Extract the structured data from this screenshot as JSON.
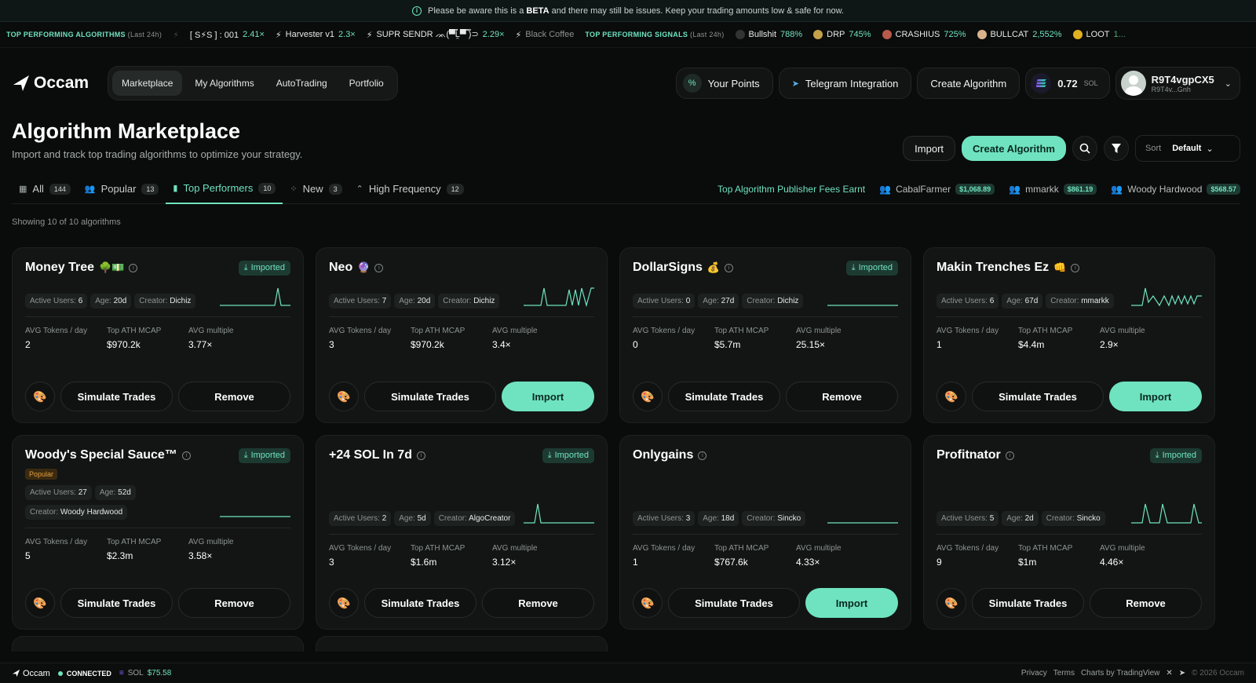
{
  "beta": {
    "pre": "Please be aware this is a",
    "bold": "BETA",
    "post": "and there may still be issues. Keep your trading amounts low & safe for now."
  },
  "ticker": {
    "algos_label": "TOP PERFORMING ALGORITHMS",
    "algos_sub": "(Last 24h)",
    "algos": [
      {
        "name": "[ S⚡S ] : 001",
        "value": "2.41×"
      },
      {
        "name": "Harvester v1",
        "value": "2.3×"
      },
      {
        "name": "SUPR SENDR ᨏ(▀̿Ĺ̯▀̿ ̿)⊃",
        "value": "2.29×"
      },
      {
        "name": "Black Coffee",
        "value": ""
      }
    ],
    "signals_label": "TOP PERFORMING SIGNALS",
    "signals_sub": "(Last 24h)",
    "signals": [
      {
        "name": "Bullshit",
        "value": "788%"
      },
      {
        "name": "DRP",
        "value": "745%"
      },
      {
        "name": "CRASHIUS",
        "value": "725%"
      },
      {
        "name": "BULLCAT",
        "value": "2,552%"
      },
      {
        "name": "LOOT",
        "value": "1..."
      }
    ]
  },
  "header": {
    "logo": "Occam",
    "nav": [
      "Marketplace",
      "My Algorithms",
      "AutoTrading",
      "Portfolio"
    ],
    "points": "Your Points",
    "telegram": "Telegram Integration",
    "create": "Create Algorithm",
    "sol_amount": "0.72",
    "sol_unit": "SOL",
    "user_name": "R9T4vgpCX5",
    "user_sub": "R9T4v...Gnh"
  },
  "page": {
    "title": "Algorithm Marketplace",
    "subtitle": "Import and track top trading algorithms to optimize your strategy.",
    "import": "Import",
    "create": "Create Algorithm",
    "sort_label": "Sort",
    "sort_value": "Default",
    "showing": "Showing 10 of 10 algorithms"
  },
  "tabs": [
    {
      "label": "All",
      "count": "144"
    },
    {
      "label": "Popular",
      "count": "13"
    },
    {
      "label": "Top Performers",
      "count": "10"
    },
    {
      "label": "New",
      "count": "3"
    },
    {
      "label": "High Frequency",
      "count": "12"
    }
  ],
  "fees": {
    "title": "Top Algorithm Publisher Fees Earnt",
    "items": [
      {
        "name": "CabalFarmer",
        "amount": "$1,068.89"
      },
      {
        "name": "mmarkk",
        "amount": "$861.19"
      },
      {
        "name": "Woody Hardwood",
        "amount": "$568.57"
      }
    ]
  },
  "labels": {
    "active_users": "Active Users:",
    "age": "Age:",
    "creator": "Creator:",
    "avg_tokens": "AVG Tokens / day",
    "top_ath": "Top ATH MCAP",
    "avg_multiple": "AVG multiple",
    "simulate": "Simulate Trades",
    "remove": "Remove",
    "import": "Import",
    "imported": "Imported",
    "popular": "Popular"
  },
  "cards": [
    {
      "name": "Money Tree",
      "emoji": "🌳💵",
      "imported": true,
      "users": "6",
      "age": "20d",
      "creator": "Dichiz",
      "tokens": "2",
      "ath": "$970.2k",
      "multiple": "3.77×"
    },
    {
      "name": "Neo",
      "emoji": "🔮",
      "imported": false,
      "users": "7",
      "age": "20d",
      "creator": "Dichiz",
      "tokens": "3",
      "ath": "$970.2k",
      "multiple": "3.4×"
    },
    {
      "name": "DollarSigns",
      "emoji": "💰",
      "imported": true,
      "users": "0",
      "age": "27d",
      "creator": "Dichiz",
      "tokens": "0",
      "ath": "$5.7m",
      "multiple": "25.15×"
    },
    {
      "name": "Makin Trenches Ez",
      "emoji": "👊",
      "imported": false,
      "users": "6",
      "age": "67d",
      "creator": "mmarkk",
      "tokens": "1",
      "ath": "$4.4m",
      "multiple": "2.9×"
    },
    {
      "name": "Woody's Special Sauce™",
      "emoji": "",
      "imported": true,
      "popular": true,
      "users": "27",
      "age": "52d",
      "creator": "Woody Hardwood",
      "tokens": "5",
      "ath": "$2.3m",
      "multiple": "3.58×"
    },
    {
      "name": "+24 SOL In 7d",
      "emoji": "",
      "imported": true,
      "users": "2",
      "age": "5d",
      "creator": "AlgoCreator",
      "tokens": "3",
      "ath": "$1.6m",
      "multiple": "3.12×"
    },
    {
      "name": "Onlygains",
      "emoji": "",
      "imported": false,
      "users": "3",
      "age": "18d",
      "creator": "Sincko",
      "tokens": "1",
      "ath": "$767.6k",
      "multiple": "4.33×"
    },
    {
      "name": "Profitnator",
      "emoji": "",
      "imported": true,
      "users": "5",
      "age": "2d",
      "creator": "Sincko",
      "tokens": "9",
      "ath": "$1m",
      "multiple": "4.46×"
    }
  ],
  "footer": {
    "logo": "Occam",
    "status": "CONNECTED",
    "sol_label": "SOL",
    "sol_price": "$75.58",
    "links": [
      "Privacy",
      "Terms",
      "Charts by TradingView"
    ],
    "copyright": "© 2026 Occam"
  },
  "colors": {
    "accent": "#6fe3bf",
    "background": "#0a0b0b",
    "card": "#121514"
  }
}
